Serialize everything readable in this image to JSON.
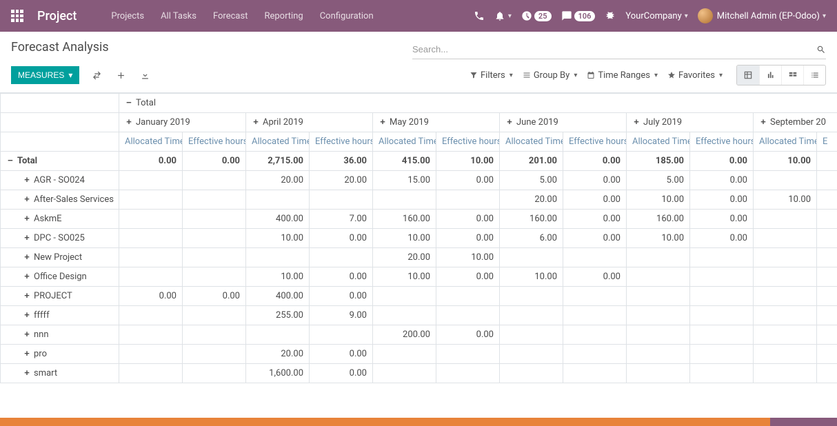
{
  "header": {
    "brand": "Project",
    "nav": [
      "Projects",
      "All Tasks",
      "Forecast",
      "Reporting",
      "Configuration"
    ],
    "activities_badge": "25",
    "discuss_badge": "106",
    "company": "YourCompany",
    "user": "Mitchell Admin (EP-Odoo)"
  },
  "page": {
    "title": "Forecast Analysis",
    "search_placeholder": "Search...",
    "measures_btn": "MEASURES",
    "filters_label": "Filters",
    "groupby_label": "Group By",
    "timerange_label": "Time Ranges",
    "favorites_label": "Favorites"
  },
  "pivot": {
    "total_label": "Total",
    "months": [
      "January 2019",
      "April 2019",
      "May 2019",
      "June 2019",
      "July 2019",
      "September 20"
    ],
    "measure_labels": [
      "Allocated Time",
      "Effective hours"
    ],
    "last_col_labels": [
      "Allocated Time",
      "E"
    ],
    "rows": [
      {
        "label": "Total",
        "indent": 0,
        "expanded": true,
        "cells": [
          "0.00",
          "0.00",
          "2,715.00",
          "36.00",
          "415.00",
          "10.00",
          "201.00",
          "0.00",
          "185.00",
          "0.00",
          "10.00",
          ""
        ],
        "is_total": true
      },
      {
        "label": "AGR - SO024",
        "indent": 1,
        "expanded": false,
        "cells": [
          "",
          "",
          "20.00",
          "20.00",
          "15.00",
          "0.00",
          "5.00",
          "0.00",
          "5.00",
          "0.00",
          "",
          ""
        ]
      },
      {
        "label": "After-Sales Services",
        "indent": 1,
        "expanded": false,
        "cells": [
          "",
          "",
          "",
          "",
          "",
          "",
          "20.00",
          "0.00",
          "10.00",
          "0.00",
          "10.00",
          ""
        ]
      },
      {
        "label": "AskmE",
        "indent": 1,
        "expanded": false,
        "cells": [
          "",
          "",
          "400.00",
          "7.00",
          "160.00",
          "0.00",
          "160.00",
          "0.00",
          "160.00",
          "0.00",
          "",
          ""
        ]
      },
      {
        "label": "DPC - SO025",
        "indent": 1,
        "expanded": false,
        "cells": [
          "",
          "",
          "10.00",
          "0.00",
          "10.00",
          "0.00",
          "6.00",
          "0.00",
          "10.00",
          "0.00",
          "",
          ""
        ]
      },
      {
        "label": "New Project",
        "indent": 1,
        "expanded": false,
        "cells": [
          "",
          "",
          "",
          "",
          "20.00",
          "10.00",
          "",
          "",
          "",
          "",
          "",
          ""
        ]
      },
      {
        "label": "Office Design",
        "indent": 1,
        "expanded": false,
        "cells": [
          "",
          "",
          "10.00",
          "0.00",
          "10.00",
          "0.00",
          "10.00",
          "0.00",
          "",
          "",
          "",
          ""
        ]
      },
      {
        "label": "PROJECT",
        "indent": 1,
        "expanded": false,
        "cells": [
          "0.00",
          "0.00",
          "400.00",
          "0.00",
          "",
          "",
          "",
          "",
          "",
          "",
          "",
          ""
        ]
      },
      {
        "label": "fffff",
        "indent": 1,
        "expanded": false,
        "cells": [
          "",
          "",
          "255.00",
          "9.00",
          "",
          "",
          "",
          "",
          "",
          "",
          "",
          ""
        ]
      },
      {
        "label": "nnn",
        "indent": 1,
        "expanded": false,
        "cells": [
          "",
          "",
          "",
          "",
          "200.00",
          "0.00",
          "",
          "",
          "",
          "",
          "",
          ""
        ]
      },
      {
        "label": "pro",
        "indent": 1,
        "expanded": false,
        "cells": [
          "",
          "",
          "20.00",
          "0.00",
          "",
          "",
          "",
          "",
          "",
          "",
          "",
          ""
        ]
      },
      {
        "label": "smart",
        "indent": 1,
        "expanded": false,
        "cells": [
          "",
          "",
          "1,600.00",
          "0.00",
          "",
          "",
          "",
          "",
          "",
          "",
          "",
          ""
        ]
      }
    ]
  }
}
